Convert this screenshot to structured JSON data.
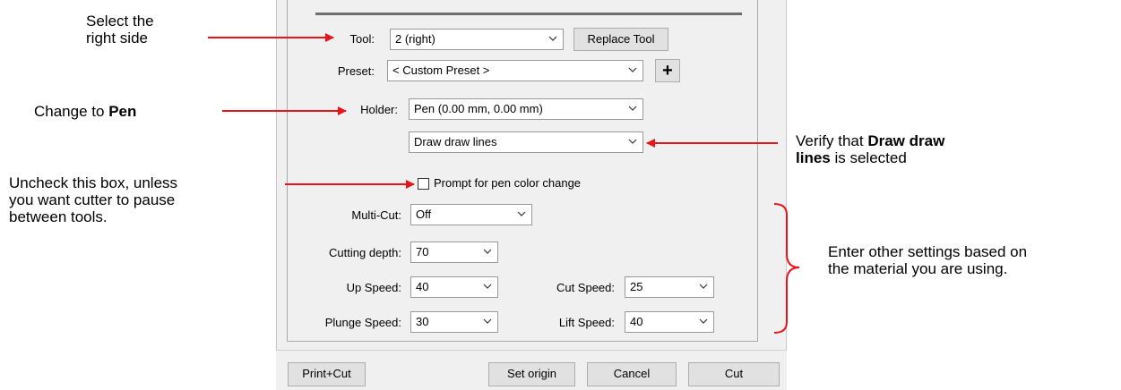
{
  "annotations": {
    "select_right_line1": "Select the",
    "select_right_line2": "right side",
    "change_prefix": "Change to ",
    "change_bold": "Pen",
    "verify_line1_prefix": "Verify that ",
    "verify_line1_bold": "Draw draw",
    "verify_line2_bold": "lines",
    "verify_line2_suffix": " is selected",
    "uncheck_line1": "Uncheck this box, unless",
    "uncheck_line2": "you want cutter to pause",
    "uncheck_line3": "between tools.",
    "enter_line1": "Enter other settings based on",
    "enter_line2": "the material you are using."
  },
  "colors": {
    "arrow": "#e8141c",
    "bracket": "#e8141c"
  },
  "form": {
    "tool_label": "Tool:",
    "tool_value": "2 (right)",
    "replace_tool": "Replace Tool",
    "preset_label": "Preset:",
    "preset_value": "< Custom Preset >",
    "add_preset_symbol": "+",
    "holder_label": "Holder:",
    "holder_value": "Pen (0.00 mm, 0.00 mm)",
    "draw_mode_value": "Draw draw lines",
    "prompt_label": "Prompt for pen color change",
    "prompt_checked": false,
    "multicut_label": "Multi-Cut:",
    "multicut_value": "Off",
    "depth_label": "Cutting depth:",
    "depth_value": "70",
    "up_speed_label": "Up Speed:",
    "up_speed_value": "40",
    "cut_speed_label": "Cut Speed:",
    "cut_speed_value": "25",
    "plunge_speed_label": "Plunge Speed:",
    "plunge_speed_value": "30",
    "lift_speed_label": "Lift Speed:",
    "lift_speed_value": "40"
  },
  "footer": {
    "print_cut": "Print+Cut",
    "set_origin": "Set origin",
    "cancel": "Cancel",
    "cut": "Cut"
  }
}
